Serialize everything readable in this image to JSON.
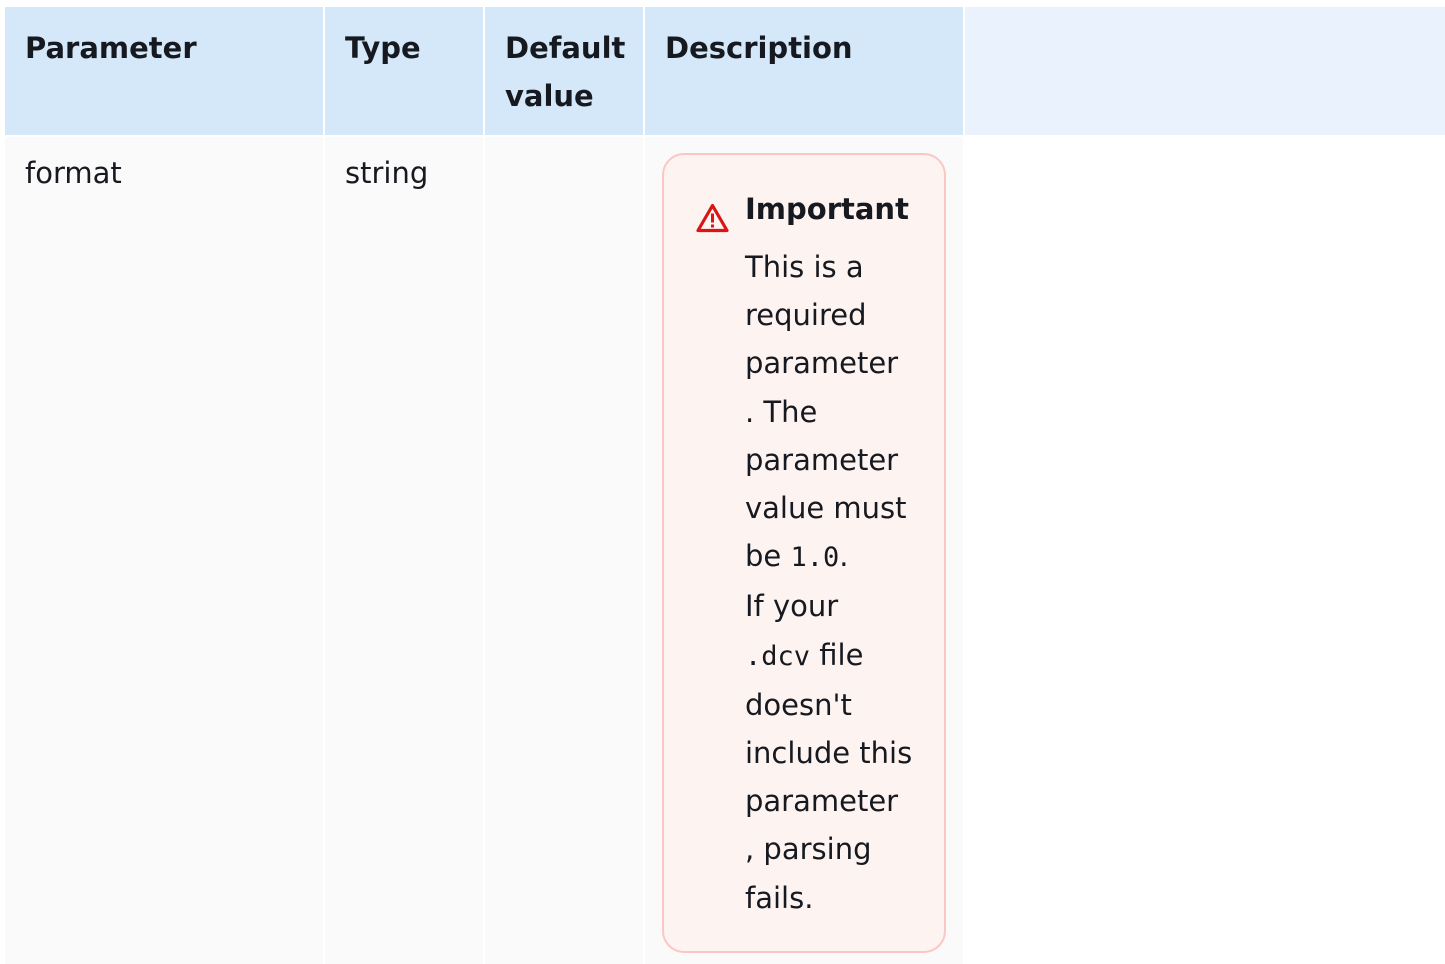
{
  "table": {
    "headers": {
      "parameter": "Parameter",
      "type": "Type",
      "default_line1": "Default",
      "default_line2": "value",
      "description": "Description"
    },
    "row": {
      "parameter": "format",
      "type": "string",
      "default_value": "",
      "alert": {
        "title": "Important",
        "l1": "This is a",
        "l2": "required",
        "l3": "parameter",
        "l4": ". The",
        "l5": "parameter",
        "l6": "value must",
        "l7_pre": "be ",
        "l7_code": "1.0",
        "l7_post": ".",
        "l8": "If your",
        "l9_code": ".dcv",
        "l9_post": " file",
        "l10": "doesn't",
        "l11": "include this",
        "l12": "parameter",
        "l13": ", parsing",
        "l14": "fails."
      }
    }
  },
  "colors": {
    "header_bg": "#d5e8f9",
    "header_extra_bg": "#eaf3fd",
    "cell_bg": "#fafafa",
    "alert_bg": "#fdf3f1",
    "alert_border": "#fbc7c2",
    "warning_icon": "#d91515"
  },
  "icons": {
    "alert_icon": "warning-triangle-icon"
  }
}
